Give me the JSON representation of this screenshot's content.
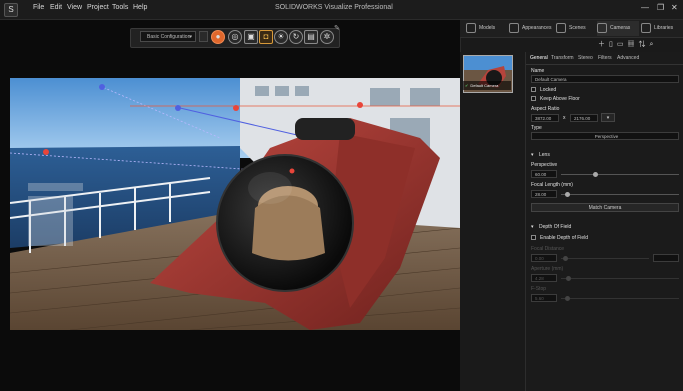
{
  "app": {
    "title": "SOLIDWORKS Visualize Professional",
    "menu": [
      "File",
      "Edit",
      "View",
      "Project",
      "Tools",
      "Help"
    ]
  },
  "toolbar": {
    "configuration": "Basic Configuration"
  },
  "panel": {
    "tabs": [
      "Models",
      "Appearances",
      "Scenes",
      "Cameras",
      "Libraries"
    ],
    "thumbnail_label": "Default Camera"
  },
  "properties": {
    "tabs": [
      "General",
      "Transform",
      "Stereo",
      "Filters",
      "Advanced"
    ],
    "name_label": "Name",
    "name_value": "Default Camera",
    "locked_label": "Locked",
    "keep_above_floor_label": "Keep Above Floor",
    "aspect_ratio_label": "Aspect Ratio",
    "aspect_w": "3872.00",
    "aspect_x": "x",
    "aspect_h": "2176.00",
    "type_label": "Type",
    "type_value": "Perspective",
    "lens_header": "Lens",
    "perspective_label": "Perspective",
    "perspective_value": "60.00",
    "focal_length_label": "Focal Length (mm)",
    "focal_length_value": "28.00",
    "match_camera_button": "Match Camera",
    "depth_of_field_header": "Depth Of Field",
    "enable_dof_label": "Enable Depth of Field",
    "focal_distance_label": "Focal Distance",
    "focal_distance_value": "0.00",
    "aperture_label": "Aperture (mm)",
    "aperture_value": "4.28",
    "fstop_label": "F-Stop",
    "fstop_value": "5.60"
  },
  "colors": {
    "accent_orange": "#e0672c",
    "check_green": "#5bc46a",
    "panel_bg": "#1b1b1b",
    "sub_body_red": "#a83a34"
  }
}
